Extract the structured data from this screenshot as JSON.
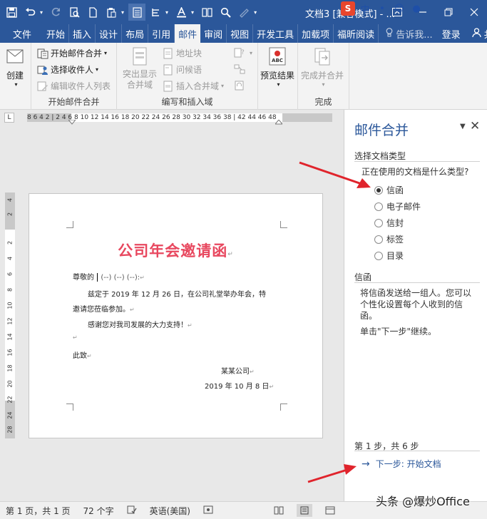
{
  "window": {
    "title": "文档3 [兼容模式] - ...",
    "qat": [
      "save-icon",
      "undo-icon",
      "redo-icon",
      "print-preview-icon",
      "new-document-icon",
      "paste-icon",
      "draw-table-icon",
      "paragraph-icon",
      "font-color-icon",
      "columns-icon",
      "find-icon",
      "format-painter-icon"
    ]
  },
  "tabs": {
    "file": "文件",
    "home": "开始",
    "insert": "插入",
    "design": "设计",
    "layout": "布局",
    "references": "引用",
    "mailings": "邮件",
    "review": "审阅",
    "view": "视图",
    "developer": "开发工具",
    "addins": "加载项",
    "foxit": "福昕阅读",
    "tell_me": "告诉我...",
    "sign_in": "登录",
    "share": "共享"
  },
  "ribbon": {
    "create": "创建",
    "start_merge": "开始邮件合并",
    "select_recipients": "选择收件人",
    "edit_recipients": "编辑收件人列表",
    "group_start": "开始邮件合并",
    "highlight_fields": "突出显示合并域",
    "address_block": "地址块",
    "greeting_line": "问候语",
    "insert_field": "插入合并域",
    "group_write": "编写和插入域",
    "preview_results": "预览结果",
    "finish_merge": "完成并合并",
    "group_finish": "完成"
  },
  "ruler": {
    "numbers": "8  6  4  2  |  2  4  6  8  10  12  14  16  18  20  22  24  26  28  30  32  34  36  38  |  42  44  46  48",
    "vertical": [
      "4",
      "2",
      "2",
      "4",
      "6",
      "8",
      "10",
      "12",
      "14",
      "16",
      "18",
      "20",
      "22",
      "24",
      "26",
      "28"
    ]
  },
  "document": {
    "heading": "公司年会邀请函",
    "salutation": "尊敬的",
    "fields": "(--) (--) (--):",
    "para1": "兹定于 2019 年 12 月 26 日，在公司礼堂举办年会，特",
    "para2": "邀请您莅临参加。",
    "para3": "感谢您对我司发展的大力支持！",
    "closing": "此致",
    "company": "某某公司",
    "date": "2019 年 10 月 8 日"
  },
  "pane": {
    "title": "邮件合并",
    "section1": "选择文档类型",
    "question": "正在使用的文档是什么类型?",
    "options": [
      "信函",
      "电子邮件",
      "信封",
      "标签",
      "目录"
    ],
    "selected": 0,
    "section2": "信函",
    "desc1": "将信函发送给一组人。您可以个性化设置每个人收到的信函。",
    "desc2": "单击\"下一步\"继续。",
    "step": "第 1 步，共 6 步",
    "next": "下一步: 开始文档"
  },
  "status": {
    "page": "第 1 页，共 1 页",
    "words": "72 个字",
    "language": "英语(美国)"
  },
  "watermark": "头条 @爆炒Office",
  "colors": {
    "ribbon_blue": "#2b579a",
    "heading_red": "#e8485f",
    "arrow_red": "#e0242c"
  }
}
